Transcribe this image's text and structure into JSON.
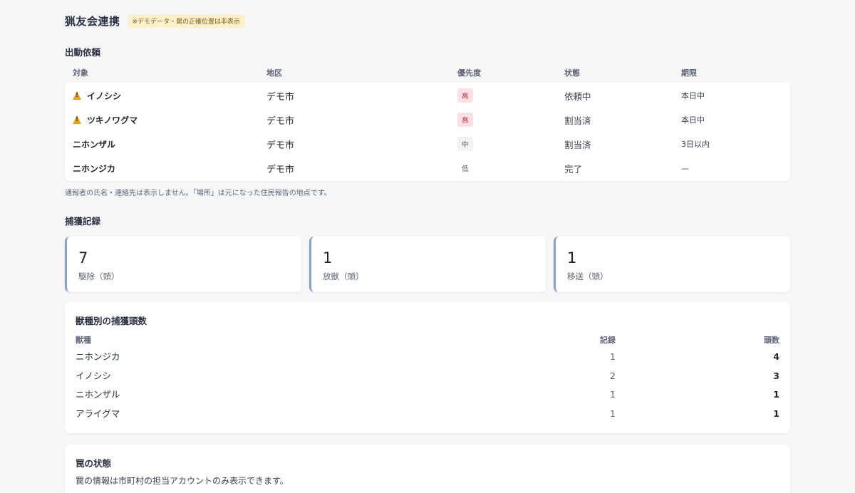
{
  "header": {
    "title": "猟友会連携",
    "demo_badge": "※デモデータ・罠の正確位置は非表示"
  },
  "requests": {
    "section_title": "出動依頼",
    "columns": {
      "target": "対象",
      "area": "地区",
      "priority": "優先度",
      "status": "状態",
      "deadline": "期限"
    },
    "rows": [
      {
        "target": "イノシシ",
        "warning": true,
        "area": "デモ市",
        "priority": "高",
        "priority_level": "high",
        "status": "依頼中",
        "deadline": "本日中"
      },
      {
        "target": "ツキノワグマ",
        "warning": true,
        "area": "デモ市",
        "priority": "高",
        "priority_level": "high",
        "status": "割当済",
        "deadline": "本日中"
      },
      {
        "target": "ニホンザル",
        "warning": false,
        "area": "デモ市",
        "priority": "中",
        "priority_level": "mid",
        "status": "割当済",
        "deadline": "3日以内"
      },
      {
        "target": "ニホンジカ",
        "warning": false,
        "area": "デモ市",
        "priority": "低",
        "priority_level": "low",
        "status": "完了",
        "deadline": "—"
      }
    ],
    "note": "通報者の氏名・連絡先は表示しません。「場所」は元になった住民報告の地点です。"
  },
  "captures": {
    "section_title": "捕獲記録",
    "stats": [
      {
        "value": "7",
        "label": "駆除（頭）"
      },
      {
        "value": "1",
        "label": "放獣（頭）"
      },
      {
        "value": "1",
        "label": "移送（頭）"
      }
    ],
    "species": {
      "title": "獣種別の捕獲頭数",
      "columns": {
        "species": "獣種",
        "records": "記録",
        "count": "頭数"
      },
      "rows": [
        {
          "species": "ニホンジカ",
          "records": "1",
          "count": "4"
        },
        {
          "species": "イノシシ",
          "records": "2",
          "count": "3"
        },
        {
          "species": "ニホンザル",
          "records": "1",
          "count": "1"
        },
        {
          "species": "アライグマ",
          "records": "1",
          "count": "1"
        }
      ]
    }
  },
  "traps": {
    "title": "罠の状態",
    "text": "罠の情報は市町村の担当アカウントのみ表示できます。"
  },
  "colors": {
    "accent_border": "#8aa0bd",
    "priority_high_bg": "#fbe1e4",
    "priority_high_text": "#b33045",
    "warning_icon": "#e9a321",
    "demo_badge_bg": "#fdf1cc"
  }
}
